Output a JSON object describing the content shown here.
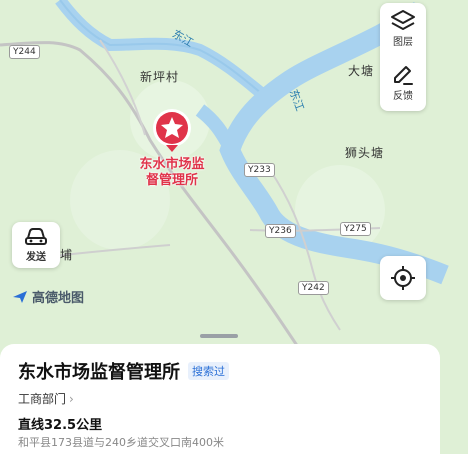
{
  "map": {
    "roads": [
      "Y244",
      "Y233",
      "Y236",
      "Y275",
      "Y242"
    ],
    "places": [
      "新坪村",
      "大塘",
      "狮头塘",
      "埔"
    ],
    "rivers": [
      "东江",
      "东江"
    ]
  },
  "poi": {
    "name_line1": "东水市场监",
    "name_line2": "督管理所",
    "color": "#e0334a"
  },
  "controls": {
    "layers_label": "图层",
    "feedback_label": "反馈",
    "send_label": "发送"
  },
  "brand": "高德地图",
  "card": {
    "title": "东水市场监督管理所",
    "badge": "搜索过",
    "category": "工商部门",
    "distance": "直线32.5公里",
    "address": "和平县173县道与240乡道交叉口南400米"
  },
  "colors": {
    "land": "#dff0d6",
    "river": "#a8d2ef",
    "accent": "#2a6fd6"
  }
}
